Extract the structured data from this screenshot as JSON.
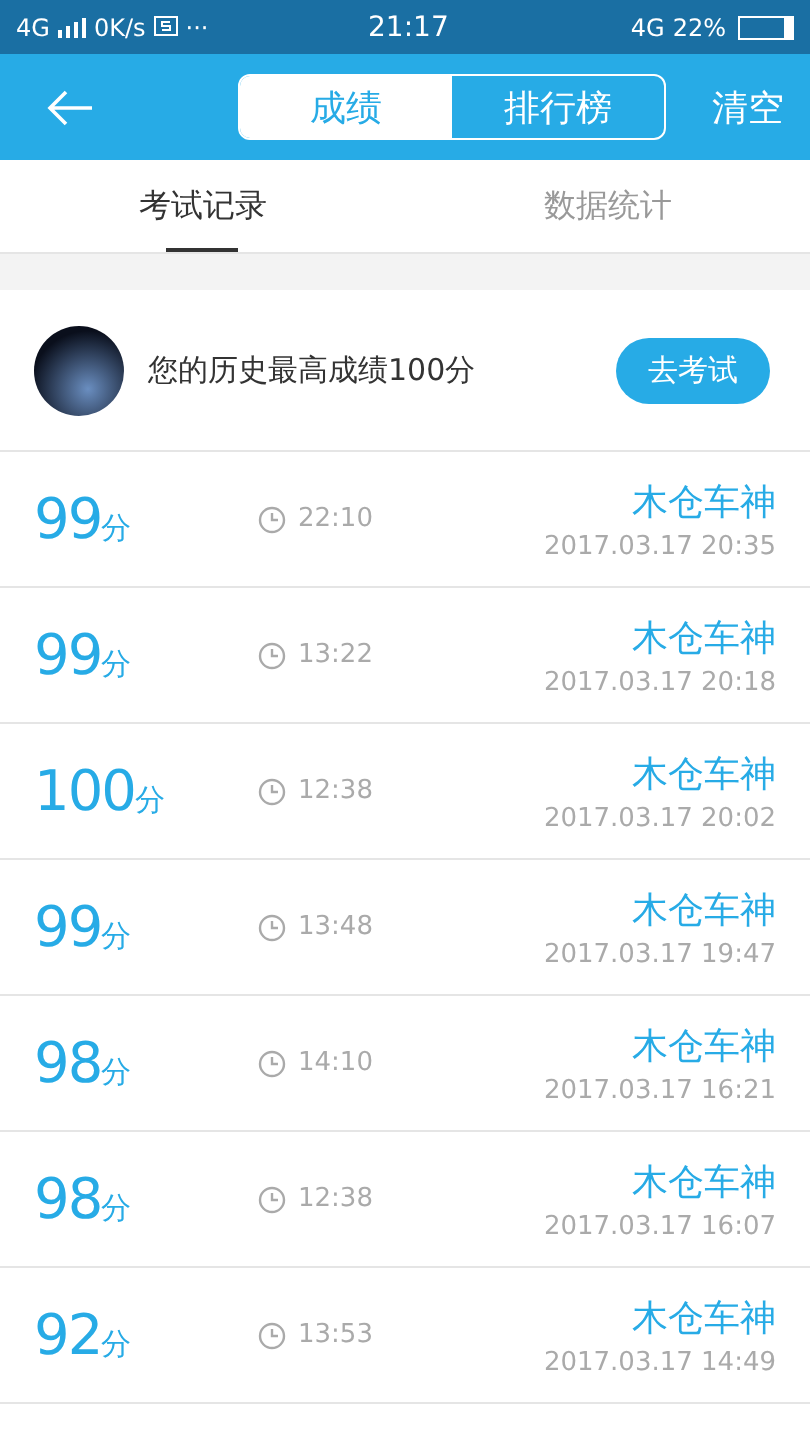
{
  "status_bar": {
    "network": "4G",
    "speed": "0K/s",
    "more": "···",
    "time": "21:17",
    "network_right": "4G",
    "battery_percent": "22%"
  },
  "header": {
    "segments": [
      {
        "label": "成绩",
        "selected": true
      },
      {
        "label": "排行榜",
        "selected": false
      }
    ],
    "action": "清空"
  },
  "tabs": [
    {
      "label": "考试记录",
      "selected": true
    },
    {
      "label": "数据统计",
      "selected": false
    }
  ],
  "best": {
    "text": "您的历史最高成绩100分",
    "button": "去考试"
  },
  "records": [
    {
      "score": "99",
      "unit": "分",
      "duration": "22:10",
      "name": "木仓车神",
      "date": "2017.03.17  20:35"
    },
    {
      "score": "99",
      "unit": "分",
      "duration": "13:22",
      "name": "木仓车神",
      "date": "2017.03.17  20:18"
    },
    {
      "score": "100",
      "unit": "分",
      "duration": "12:38",
      "name": "木仓车神",
      "date": "2017.03.17  20:02"
    },
    {
      "score": "99",
      "unit": "分",
      "duration": "13:48",
      "name": "木仓车神",
      "date": "2017.03.17  19:47"
    },
    {
      "score": "98",
      "unit": "分",
      "duration": "14:10",
      "name": "木仓车神",
      "date": "2017.03.17  16:21"
    },
    {
      "score": "98",
      "unit": "分",
      "duration": "12:38",
      "name": "木仓车神",
      "date": "2017.03.17  16:07"
    },
    {
      "score": "92",
      "unit": "分",
      "duration": "13:53",
      "name": "木仓车神",
      "date": "2017.03.17  14:49"
    }
  ]
}
